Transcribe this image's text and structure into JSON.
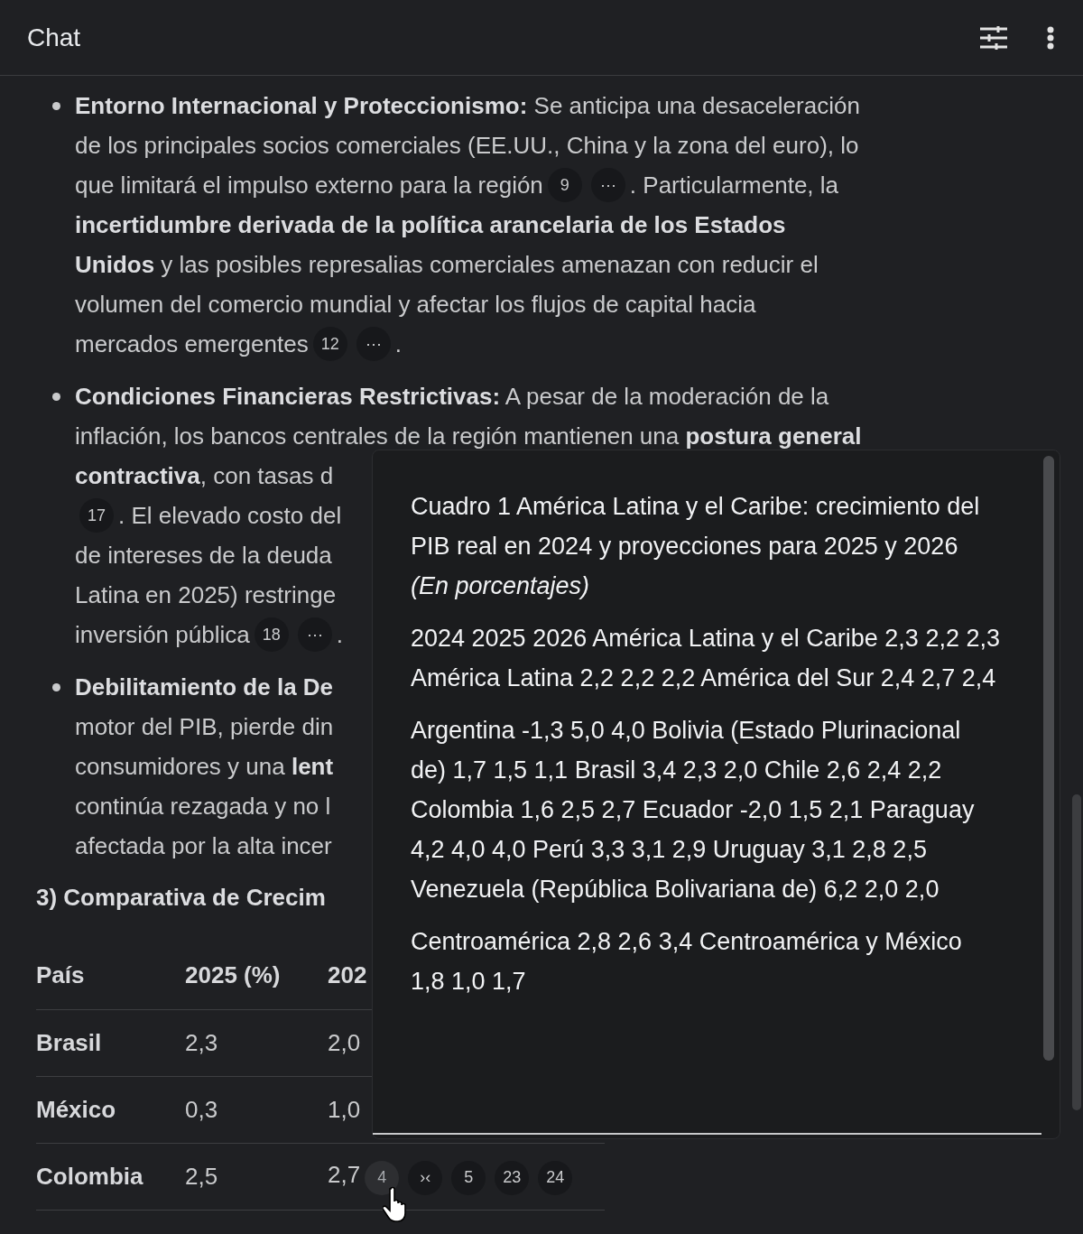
{
  "header": {
    "title": "Chat"
  },
  "bullets": [
    {
      "lines": [
        [
          {
            "kind": "text",
            "text": "**Entorno Internacional y Proteccionismo:** Se anticipa una desaceleración"
          }
        ],
        [
          {
            "kind": "text",
            "text": "de los principales socios comerciales (EE.UU., China y la zona del euro), lo"
          }
        ],
        [
          {
            "kind": "text",
            "text": "que limitará el impulso externo para la región"
          },
          {
            "kind": "chip",
            "text": "9"
          },
          {
            "kind": "chip",
            "text": "⋯"
          },
          {
            "kind": "text",
            "text": ". Particularmente, la"
          }
        ],
        [
          {
            "kind": "text",
            "text": "**incertidumbre derivada de la política arancelaria de los Estados**"
          }
        ],
        [
          {
            "kind": "text",
            "text": "**Unidos** y las posibles represalias comerciales amenazan con reducir el"
          }
        ],
        [
          {
            "kind": "text",
            "text": "volumen del comercio mundial y afectar los flujos de capital hacia"
          }
        ],
        [
          {
            "kind": "text",
            "text": "mercados emergentes"
          },
          {
            "kind": "chip",
            "text": "12"
          },
          {
            "kind": "chip",
            "text": "⋯"
          },
          {
            "kind": "text",
            "text": "."
          }
        ]
      ]
    },
    {
      "lines": [
        [
          {
            "kind": "text",
            "text": "**Condiciones Financieras Restrictivas:** A pesar de la moderación de la"
          }
        ],
        [
          {
            "kind": "text",
            "text": "inflación, los bancos centrales de la región mantienen una **postura general**"
          }
        ],
        [
          {
            "kind": "text",
            "text": "**contractiva**, con tasas d"
          }
        ],
        [
          {
            "kind": "chip",
            "text": "17"
          },
          {
            "kind": "text",
            "text": ". El elevado costo del"
          }
        ],
        [
          {
            "kind": "text",
            "text": "de intereses de la deuda"
          }
        ],
        [
          {
            "kind": "text",
            "text": "Latina en 2025) restringe"
          }
        ],
        [
          {
            "kind": "text",
            "text": "inversión pública"
          },
          {
            "kind": "chip",
            "text": "18"
          },
          {
            "kind": "chip",
            "text": "⋯"
          },
          {
            "kind": "text",
            "text": "."
          }
        ]
      ]
    },
    {
      "lines": [
        [
          {
            "kind": "text",
            "text": "**Debilitamiento de la De**"
          }
        ],
        [
          {
            "kind": "text",
            "text": "motor del PIB, pierde din"
          }
        ],
        [
          {
            "kind": "text",
            "text": "consumidores y una **lent**"
          }
        ],
        [
          {
            "kind": "text",
            "text": "continúa rezagada y no l"
          }
        ],
        [
          {
            "kind": "text",
            "text": "afectada por la alta incer"
          }
        ]
      ]
    }
  ],
  "section_heading": "3) Comparativa de Crecim",
  "table": {
    "columns": [
      "País",
      "2025 (%)",
      "202"
    ],
    "rows": [
      {
        "cells": [
          "Brasil",
          "2,3",
          "2,0"
        ]
      },
      {
        "cells": [
          "México",
          "0,3",
          "1,0"
        ]
      },
      {
        "cells": [
          "Colombia",
          "2,5",
          "2,7"
        ],
        "citations": [
          {
            "text": "4",
            "selected": true
          },
          {
            "text": "›‹",
            "selected": false
          },
          {
            "text": "5",
            "selected": false
          },
          {
            "text": "23",
            "selected": false
          },
          {
            "text": "24",
            "selected": false
          }
        ]
      }
    ]
  },
  "popup": {
    "paragraphs": [
      "Cuadro 1 América Latina y el Caribe: crecimiento del PIB real en 2024 y proyecciones para 2025 y 2026 *(En porcentajes)*",
      "2024 2025 2026 América Latina y el Caribe 2,3 2,2 2,3 América Latina 2,2 2,2 2,2 América del Sur 2,4 2,7 2,4",
      "Argentina -1,3 5,0 4,0 Bolivia (Estado Plurinacional de) 1,7 1,5 1,1 Brasil 3,4 2,3 2,0 Chile 2,6 2,4 2,2 Colombia 1,6 2,5 2,7 Ecuador -2,0 1,5 2,1 Paraguay 4,2 4,0 4,0 Perú 3,3 3,1 2,9 Uruguay 3,1 2,8 2,5 Venezuela (República Bolivariana de) 6,2 2,0 2,0",
      "Centroamérica 2,8 2,6 3,4 Centroamérica y México 1,8 1,0 1,7"
    ]
  }
}
